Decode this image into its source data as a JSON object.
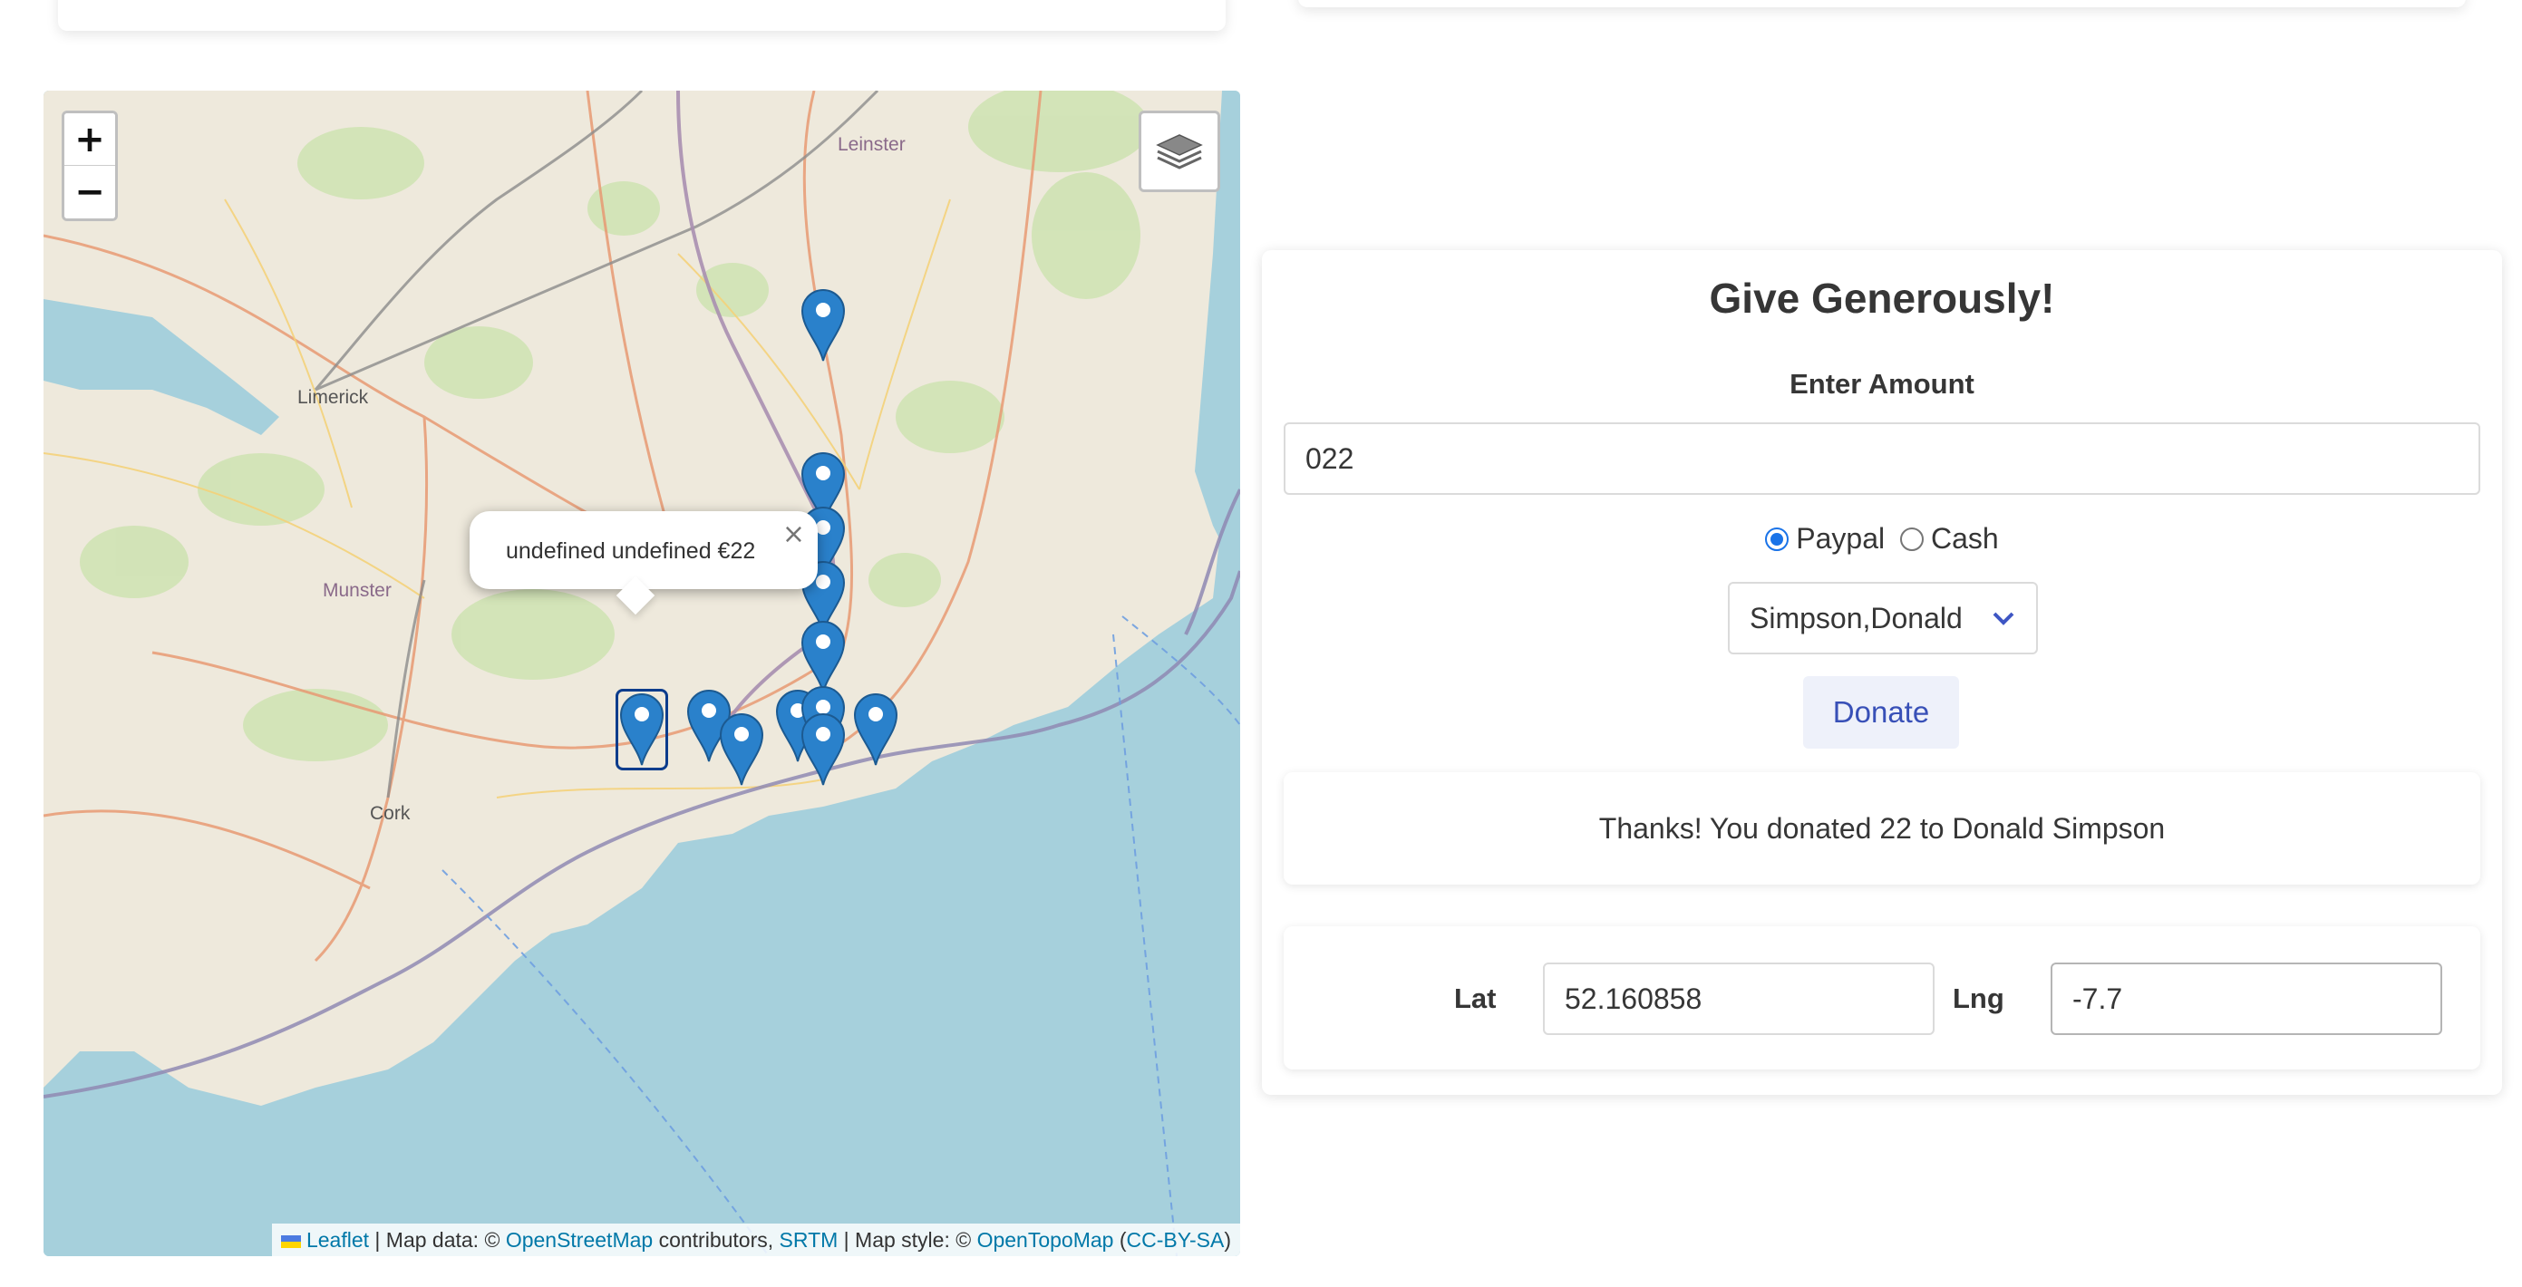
{
  "map": {
    "zoom_in": "+",
    "zoom_out": "−",
    "popup": {
      "text": "undefined undefined €22",
      "close": "×"
    },
    "place_labels": [
      "Limerick",
      "Munster",
      "Cork",
      "Leinster"
    ],
    "attribution": {
      "leaflet": "Leaflet",
      "sep1": " | Map data: © ",
      "osm": "OpenStreetMap",
      "contrib": " contributors, ",
      "srtm": "SRTM",
      "style": " | Map style: © ",
      "opentopo": "OpenTopoMap",
      "paren_open": " (",
      "ccbysa": "CC-BY-SA",
      "paren_close": ")"
    },
    "marker_count": 13
  },
  "donate_form": {
    "title": "Give Generously!",
    "amount_label": "Enter Amount",
    "amount_value": "022",
    "payment_options": [
      "Paypal",
      "Cash"
    ],
    "payment_selected": "Paypal",
    "candidate_selected": "Simpson,Donald",
    "donate_label": "Donate",
    "thanks_message": "Thanks! You donated 22 to Donald Simpson"
  },
  "location": {
    "lat_label": "Lat",
    "lat_value": "52.160858",
    "lng_label": "Lng",
    "lng_value": "-7.7"
  },
  "colors": {
    "marker": "#2a81cb",
    "sea": "#a6d0dc",
    "link": "#0078a8",
    "button_text": "#3850b7"
  }
}
